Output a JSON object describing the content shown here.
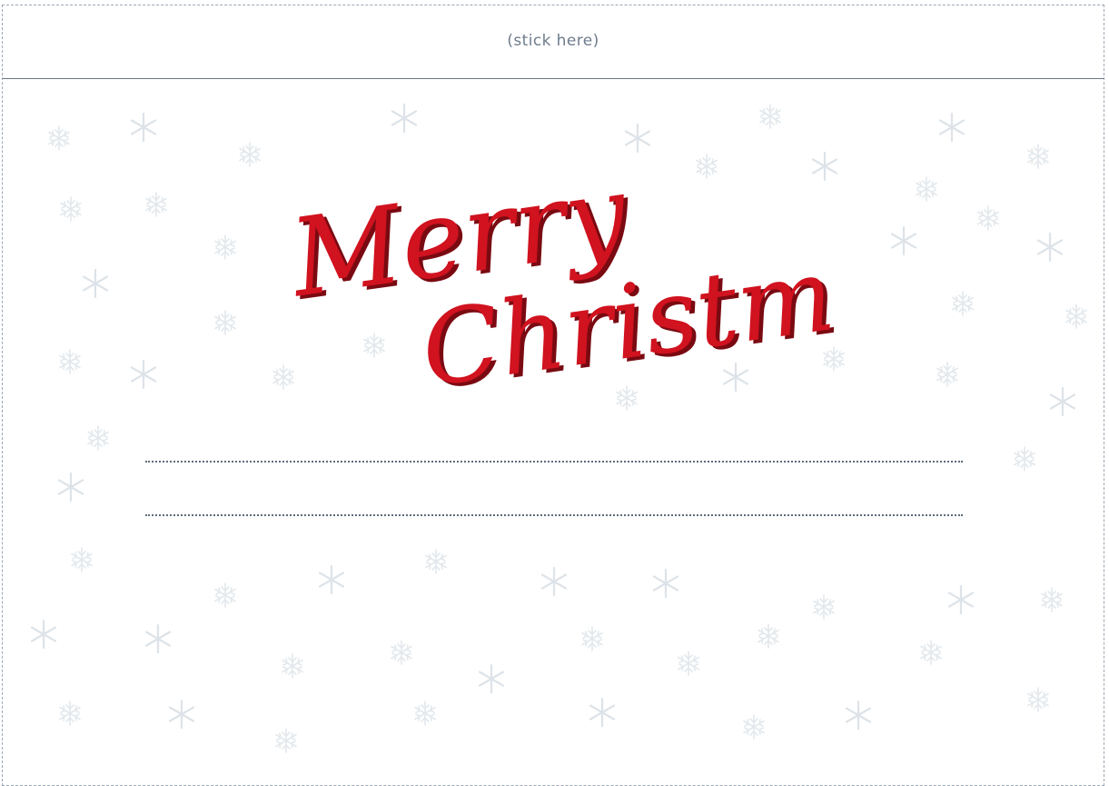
{
  "stick_strip": {
    "label": "(stick here)"
  },
  "greeting": {
    "line1": "Merry",
    "line2": "Christmas",
    "color": "#d1121f",
    "shadow_color": "#7a0a12"
  },
  "writing_lines": {
    "count": 2,
    "color": "#5c6b7a"
  },
  "decoration": {
    "icon": "snowflake-icon",
    "color": "#dde3e8"
  }
}
